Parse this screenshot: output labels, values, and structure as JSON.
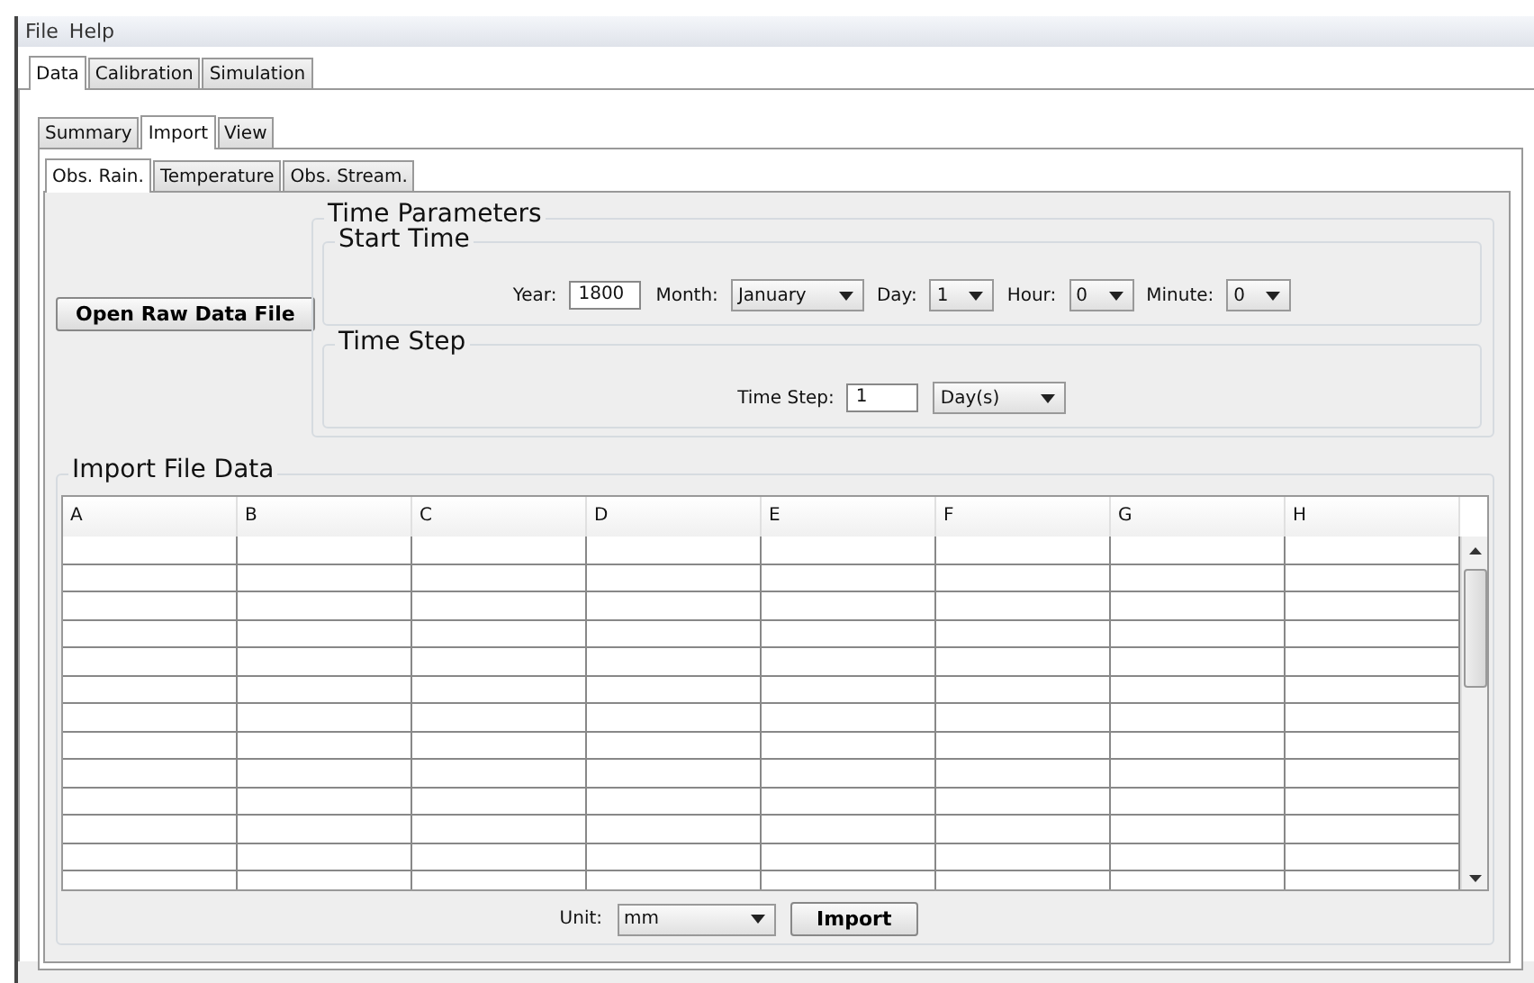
{
  "menu": [
    "File",
    "Help"
  ],
  "main_tabs": [
    {
      "label": "Data",
      "selected": true
    },
    {
      "label": "Calibration",
      "selected": false
    },
    {
      "label": "Simulation",
      "selected": false
    }
  ],
  "data_tabs": [
    {
      "label": "Summary",
      "selected": false
    },
    {
      "label": "Import",
      "selected": true
    },
    {
      "label": "View",
      "selected": false
    }
  ],
  "series_tabs": [
    {
      "label": "Obs. Rain.",
      "selected": true
    },
    {
      "label": "Temperature",
      "selected": false
    },
    {
      "label": "Obs. Stream.",
      "selected": false
    }
  ],
  "open_button": "Open Raw Data File",
  "time_parameters": {
    "title": "Time Parameters",
    "start_time": {
      "title": "Start Time",
      "fields": [
        {
          "kind": "text",
          "label": "Year:",
          "value": "1800"
        },
        {
          "kind": "dropdown",
          "label": "Month:",
          "value": "January"
        },
        {
          "kind": "dropdown",
          "label": "Day:",
          "value": "1"
        },
        {
          "kind": "dropdown",
          "label": "Hour:",
          "value": "0"
        },
        {
          "kind": "dropdown",
          "label": "Minute:",
          "value": "0"
        }
      ]
    },
    "time_step": {
      "title": "Time Step",
      "fields": [
        {
          "kind": "text",
          "label": "Time Step:",
          "value": "1"
        },
        {
          "kind": "dropdown",
          "value": "Day(s)"
        }
      ]
    }
  },
  "import_data": {
    "title": "Import File Data",
    "columns": [
      "A",
      "B",
      "C",
      "D",
      "E",
      "F",
      "G",
      "H"
    ]
  },
  "unit": {
    "label": "Unit:",
    "value": "mm"
  },
  "import_button": "Import"
}
